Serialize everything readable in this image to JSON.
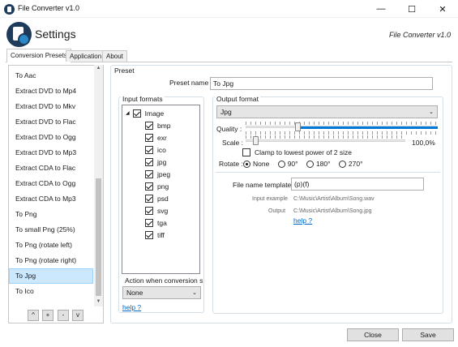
{
  "window": {
    "title": "File Converter v1.0",
    "minimize_glyph": "—",
    "maximize_glyph": "☐",
    "close_glyph": "✕"
  },
  "header": {
    "title": "Settings",
    "version": "File Converter v1.0"
  },
  "tabs": [
    {
      "label": "Conversion Presets",
      "active": true
    },
    {
      "label": "Application",
      "active": false
    },
    {
      "label": "About",
      "active": false
    }
  ],
  "presets": {
    "items": [
      "To Aac",
      "Extract DVD to Mp4",
      "Extract DVD to Mkv",
      "Extract DVD to Flac",
      "Extract DVD to Ogg",
      "Extract DVD to Mp3",
      "Extract CDA to Flac",
      "Extract CDA to Ogg",
      "Extract CDA to Mp3",
      "To Png",
      "To small Png (25%)",
      "To Png (rotate left)",
      "To Png (rotate right)",
      "To Jpg",
      "To Ico"
    ],
    "selected": "To Jpg",
    "buttons": [
      "^",
      "+",
      "-",
      "v"
    ]
  },
  "preset": {
    "group_label": "Preset",
    "name_label": "Preset name",
    "name_value": "To Jpg"
  },
  "input_formats": {
    "label": "Input formats",
    "root": "Image",
    "formats": [
      "bmp",
      "exr",
      "ico",
      "jpg",
      "jpeg",
      "png",
      "psd",
      "svg",
      "tga",
      "tiff"
    ],
    "action_label": "Action when conversion su",
    "action_value": "None",
    "help": "help ?"
  },
  "output": {
    "label": "Output format",
    "format": "Jpg",
    "quality_label": "Quality :",
    "quality": 0.27,
    "scale_label": "Scale :",
    "scale_value": "100,0%",
    "scale": 0.06,
    "clamp_label": "Clamp to lowest power of 2 size",
    "rotate_label": "Rotate :",
    "rotate_options": [
      "None",
      "90°",
      "180°",
      "270°"
    ],
    "rotate_selected": "None",
    "template_label": "File name template",
    "template_value": "(p)(f)",
    "input_example_label": "Input example",
    "input_example_value": "C:\\Music\\Artist\\Album\\Song.wav",
    "output_label": "Output",
    "output_value": "C:\\Music\\Artist\\Album\\Song.jpg",
    "help": "help ?"
  },
  "footer": {
    "close": "Close",
    "save": "Save"
  },
  "colors": {
    "accent": "#0078d7",
    "selection": "#cce8ff",
    "brand": "#1f3b5c"
  }
}
